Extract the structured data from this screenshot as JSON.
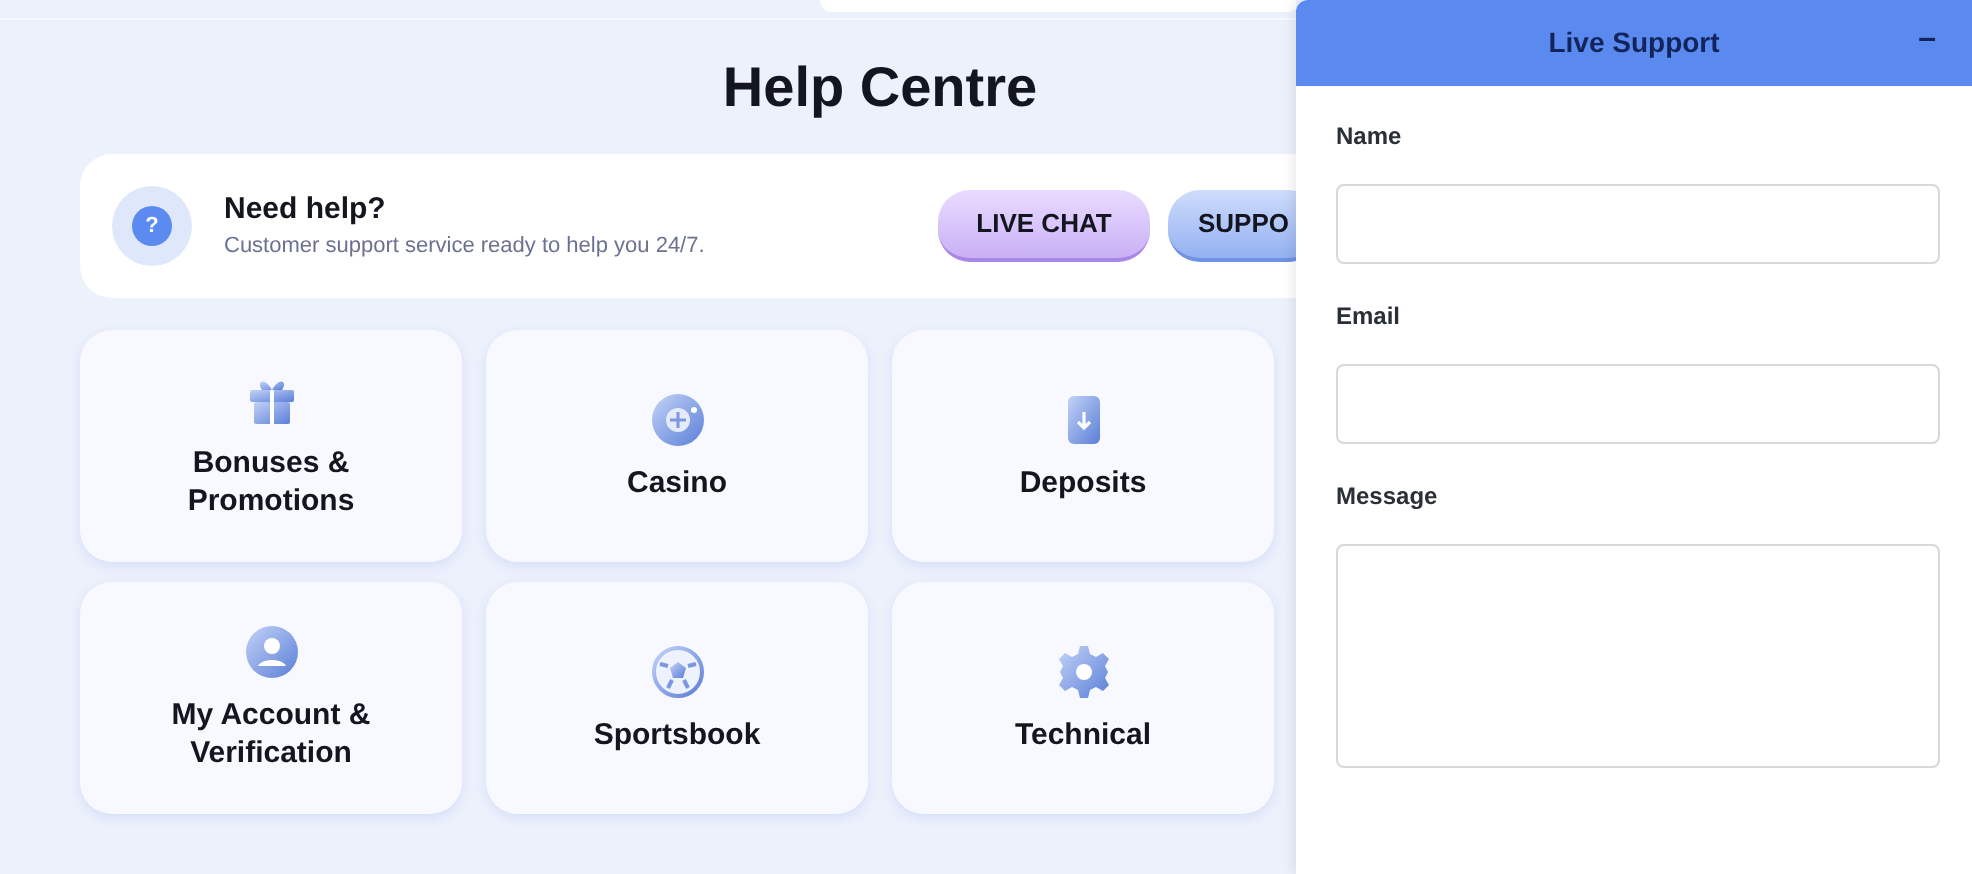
{
  "page": {
    "title": "Help Centre"
  },
  "help_banner": {
    "title": "Need help?",
    "subtitle": "Customer support service ready to help you 24/7.",
    "icon": "?",
    "buttons": [
      {
        "label": "LIVE CHAT",
        "kind": "chat"
      },
      {
        "label": "SUPPO",
        "kind": "support"
      }
    ]
  },
  "categories": [
    {
      "label": "Bonuses & Promotions",
      "kind": "gift"
    },
    {
      "label": "Casino",
      "kind": "chip"
    },
    {
      "label": "Deposits",
      "kind": "card"
    },
    {
      "label": "My Account & Verification",
      "kind": "user"
    },
    {
      "label": "Sportsbook",
      "kind": "ball"
    },
    {
      "label": "Technical",
      "kind": "gear"
    }
  ],
  "live_support": {
    "title": "Live Support",
    "minimize": "–",
    "fields": [
      {
        "label": "Name",
        "kind": "input"
      },
      {
        "label": "Email",
        "kind": "input"
      },
      {
        "label": "Message",
        "kind": "textarea"
      }
    ]
  }
}
